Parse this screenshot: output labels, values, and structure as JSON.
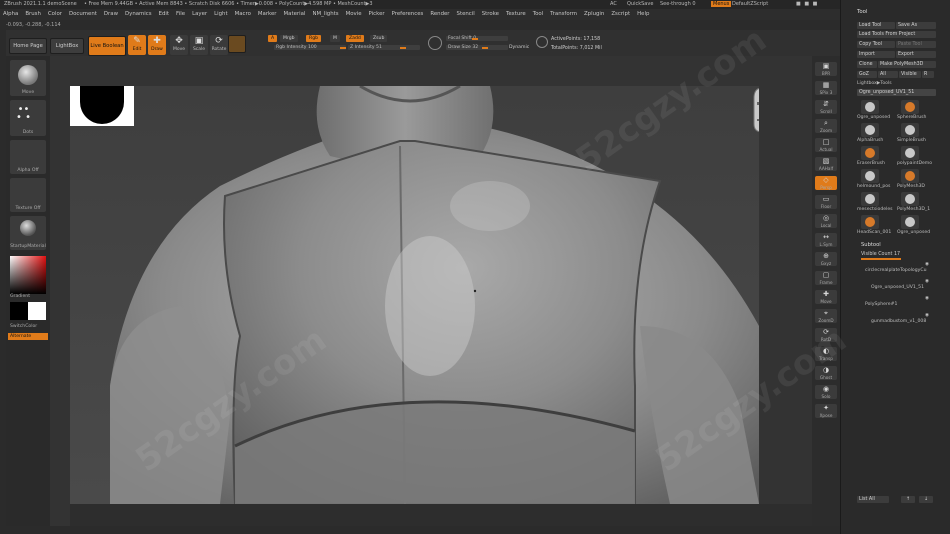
{
  "titlebar": {
    "app_title": "ZBrush 2021.1.1  demoScene",
    "stats": "• Free Mem 9.44GB • Active Mem 8843 • Scratch Disk 6606 • Timer▶0.008 • PolyCount▶4.598 MP • MeshCount▶3",
    "ac": "AC",
    "quicksave": "QuickSave",
    "see_through": "See-through  0",
    "menus": "Menus",
    "default_script": "DefaultZScript"
  },
  "menubar": {
    "items": [
      "Alpha",
      "Brush",
      "Color",
      "Document",
      "Draw",
      "Dynamics",
      "Edit",
      "File",
      "Layer",
      "Light",
      "Macro",
      "Marker",
      "Material",
      "NM_lights",
      "Movie",
      "Picker",
      "Preferences",
      "Render",
      "Stencil",
      "Stroke",
      "Texture",
      "Tool",
      "Transform",
      "Zplugin",
      "Zscript",
      "Help"
    ]
  },
  "coords": "-0.093, -0.288, -0.114",
  "shelf": {
    "home_page": "Home Page",
    "lightbox": "LightBox",
    "live_boolean": "Live Boolean",
    "edit": "Edit",
    "draw": "Draw",
    "move": "Move",
    "scale": "Scale",
    "rotate": "Rotate",
    "a_label": "A",
    "mrgb": "Mrgb",
    "rgb": "Rgb",
    "m": "M",
    "zadd": "Zadd",
    "zsub": "Zsub",
    "rgb_intensity": "Rgb Intensity 100",
    "z_intensity": "Z Intensity 51",
    "focal_shift": "Focal Shift 0",
    "draw_size": "Draw Size 32",
    "dynamic": "Dynamic",
    "active_points": "ActivePoints: 17,158",
    "total_points": "TotalPoints: 7,012 Mil"
  },
  "left": {
    "brush": "Move",
    "stroke": "Dots",
    "alpha": "Alpha Off",
    "texture": "Texture Off",
    "material": "StartupMaterial",
    "gradient": "Gradient",
    "switch_color": "SwitchColor",
    "alternate": "Alternate"
  },
  "right_shelf": {
    "items": [
      "BPR",
      "SPix 3",
      "Scroll",
      "Zoom",
      "Actual",
      "AAHalf",
      "Persp",
      "Floor",
      "Local",
      "L.Sym",
      "Gxyz",
      "Frame",
      "Move",
      "ZoomD",
      "RotD",
      "Transp",
      "Ghost",
      "Solo",
      "Xpose"
    ]
  },
  "palette": {
    "tool_header": "Tool",
    "load_tool": "Load Tool",
    "save_as": "Save As",
    "load_tools_from_project": "Load Tools From Project",
    "copy_tool": "Copy Tool",
    "paste_tool": "Paste Tool",
    "import": "Import",
    "export": "Export",
    "clone": "Clone",
    "make_polymesh": "Make PolyMesh3D",
    "goz": "GoZ",
    "all": "All",
    "visible": "Visible",
    "r": "R",
    "lightbox_tools": "Lightbox▶Tools",
    "current_tool": "Ogre_unposed_UV1_51",
    "thumbs": [
      {
        "label": "Ogre_unposed",
        "value": "51"
      },
      {
        "label": "SphereBrush",
        "value": ""
      },
      {
        "label": "AlphaBrush",
        "value": ""
      },
      {
        "label": "SimpleBrush",
        "value": ""
      },
      {
        "label": "EraserBrush",
        "value": ""
      },
      {
        "label": "polypaintDemo",
        "value": ""
      },
      {
        "label": "helmound_pos",
        "value": ""
      },
      {
        "label": "PolyMesh3D",
        "value": ""
      },
      {
        "label": "mesectsiodeles",
        "value": ""
      },
      {
        "label": "PolyMesh3D_1",
        "value": ""
      },
      {
        "label": "HeadScan_001",
        "value": ""
      },
      {
        "label": "Ogre_unposed",
        "value": ""
      }
    ],
    "subtool": "Subtool",
    "visible_count": "Visible Count 17",
    "subtools": [
      "circlecrealplateTopologyCu",
      "Ogre_unposed_UV1_51",
      "PolySphere#1",
      "gunmadbustom_v1_008"
    ],
    "list_all": "List All",
    "up_arrow": "↑",
    "down_arrow": "↓"
  },
  "colors": {
    "accent": "#e07b1a",
    "background": "#2b2b2b",
    "canvas": "#4b4b4b"
  }
}
